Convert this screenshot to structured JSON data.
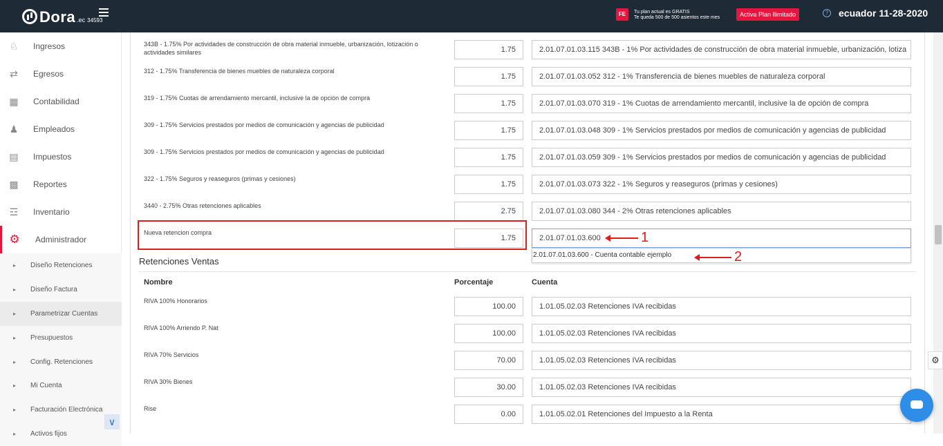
{
  "header": {
    "logo_text": "Dora",
    "logo_suffix": ".ec",
    "logo_number": "34593",
    "fe_badge": "FE",
    "plan_line1": "Tu plan actual es GRATIS",
    "plan_line2": "Te queda 500 de 500 asientos este mes",
    "plan_button": "Activa Plan Ilimitado",
    "help_icon": "?",
    "tenant": "ecuador 11-28-2020"
  },
  "sidebar": {
    "items": [
      {
        "label": "Ingresos",
        "icon": "piggy-bank-icon"
      },
      {
        "label": "Egresos",
        "icon": "cash-out-icon"
      },
      {
        "label": "Contabilidad",
        "icon": "calculator-icon"
      },
      {
        "label": "Empleados",
        "icon": "people-icon"
      },
      {
        "label": "Impuestos",
        "icon": "tax-icon"
      },
      {
        "label": "Reportes",
        "icon": "report-icon"
      },
      {
        "label": "Inventario",
        "icon": "boxes-icon"
      },
      {
        "label": "Administrador",
        "icon": "gear-icon"
      }
    ],
    "subitems": [
      {
        "label": "Diseño Retenciones"
      },
      {
        "label": "Diseño Factura"
      },
      {
        "label": "Parametrizar Cuentas"
      },
      {
        "label": "Presupuestos"
      },
      {
        "label": "Config. Retenciones"
      },
      {
        "label": "Mi Cuenta"
      },
      {
        "label": "Facturación Electrónica"
      },
      {
        "label": "Activos fijos"
      }
    ],
    "collapse_icon": "double-chevron-down-icon"
  },
  "compras_rows": [
    {
      "name": "343B - 1.75% Por actividades de construcción de obra material inmueble, urbanización, lotización o actividades similares",
      "pct": "1.75",
      "account": "2.01.07.01.03.115 343B - 1% Por actividades de construcción de obra material inmueble, urbanización, lotiza"
    },
    {
      "name": "312 - 1.75% Transferencia de bienes muebles de naturaleza corporal",
      "pct": "1.75",
      "account": "2.01.07.01.03.052 312 - 1% Transferencia de bienes muebles de naturaleza corporal"
    },
    {
      "name": "319 - 1.75% Cuotas de arrendamiento mercantil, inclusive la de opción de compra",
      "pct": "1.75",
      "account": "2.01.07.01.03.070 319 - 1% Cuotas de arrendamiento mercantil, inclusive la de opción de compra"
    },
    {
      "name": "309 - 1.75% Servicios prestados por medios de comunicación y agencias de publicidad",
      "pct": "1.75",
      "account": "2.01.07.01.03.048 309 - 1% Servicios prestados por medios de comunicación y agencias de publicidad"
    },
    {
      "name": "309 - 1.75% Servicios prestados por medios de comunicación y agencias de publicidad",
      "pct": "1.75",
      "account": "2.01.07.01.03.059 309 - 1% Servicios prestados por medios de comunicación y agencias de publicidad"
    },
    {
      "name": "322 - 1.75% Seguros y reaseguros (primas y cesiones)",
      "pct": "1.75",
      "account": "2.01.07.01.03.073 322 - 1% Seguros y reaseguros (primas y cesiones)"
    },
    {
      "name": "3440 - 2.75% Otras retenciones aplicables",
      "pct": "2.75",
      "account": "2.01.07.01.03.080 344 - 2% Otras retenciones aplicables"
    },
    {
      "name": "Nueva retencion compra",
      "pct": "1.75",
      "account": "2.01.07.01.03.600"
    }
  ],
  "autocomplete_option": "2.01.07.01.03.600 - Cuenta contable ejemplo",
  "annotations": {
    "one": "1",
    "two": "2"
  },
  "ventas": {
    "title": "Retenciones Ventas",
    "col_name": "Nombre",
    "col_pct": "Porcentaje",
    "col_account": "Cuenta",
    "rows": [
      {
        "name": "RIVA 100% Honorarios",
        "pct": "100.00",
        "account": "1.01.05.02.03 Retenciones IVA  recibidas"
      },
      {
        "name": "RIVA 100% Arriendo P. Nat",
        "pct": "100.00",
        "account": "1.01.05.02.03 Retenciones IVA  recibidas"
      },
      {
        "name": "RIVA 70% Servicios",
        "pct": "70.00",
        "account": "1.01.05.02.03 Retenciones IVA  recibidas"
      },
      {
        "name": "RIVA 30% Bienes",
        "pct": "30.00",
        "account": "1.01.05.02.03 Retenciones IVA  recibidas"
      },
      {
        "name": "Rise",
        "pct": "0.00",
        "account": "1.01.05.02.01 Retenciones del Impuesto a la Renta"
      }
    ]
  },
  "colors": {
    "brand_red": "#e3173d",
    "topbar": "#1f2a37",
    "annotation_red": "#e01b1b"
  }
}
